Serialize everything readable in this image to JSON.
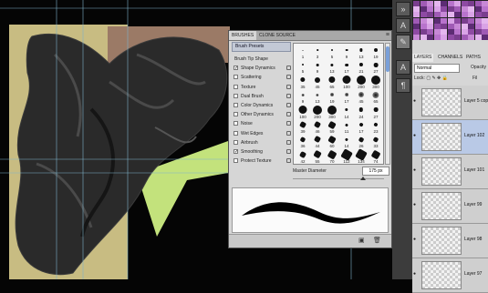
{
  "brushes_panel": {
    "tabs": [
      "BRUSHES",
      "CLONE SOURCE"
    ],
    "presets_button": "Brush Presets",
    "tip_shape_label": "Brush Tip Shape",
    "options": [
      {
        "label": "Shape Dynamics",
        "checked": true
      },
      {
        "label": "Scattering",
        "checked": false
      },
      {
        "label": "Texture",
        "checked": false
      },
      {
        "label": "Dual Brush",
        "checked": false
      },
      {
        "label": "Color Dynamics",
        "checked": false
      },
      {
        "label": "Other Dynamics",
        "checked": false
      },
      {
        "label": "Noise",
        "checked": false
      },
      {
        "label": "Wet Edges",
        "checked": false
      },
      {
        "label": "Airbrush",
        "checked": false
      },
      {
        "label": "Smoothing",
        "checked": true
      },
      {
        "label": "Protect Texture",
        "checked": false
      }
    ],
    "brush_grid": [
      [
        "1",
        "3",
        "5",
        "9",
        "13",
        "19"
      ],
      [
        "5",
        "9",
        "13",
        "17",
        "21",
        "27"
      ],
      [
        "35",
        "45",
        "65",
        "100",
        "200",
        "300"
      ],
      [
        "9",
        "13",
        "19",
        "17",
        "45",
        "65"
      ],
      [
        "100",
        "200",
        "300",
        "14",
        "24",
        "27"
      ],
      [
        "39",
        "46",
        "59",
        "11",
        "17",
        "23"
      ],
      [
        "36",
        "44",
        "60",
        "14",
        "26",
        "33"
      ],
      [
        "42",
        "55",
        "70",
        "112",
        "134",
        "74"
      ]
    ],
    "master_diameter_label": "Master Diameter",
    "master_diameter_value": "175 px"
  },
  "layers_panel": {
    "tabs": [
      "LAYERS",
      "CHANNELS",
      "PATHS"
    ],
    "blend_mode": "Normal",
    "opacity_label": "Opacity",
    "lock_label": "Lock:",
    "fill_label": "Fil",
    "layers": [
      {
        "name": "Layer 5 cop",
        "selected": false
      },
      {
        "name": "Layer 102",
        "selected": true
      },
      {
        "name": "Layer 101",
        "selected": false
      },
      {
        "name": "Layer 99",
        "selected": false
      },
      {
        "name": "Layer 98",
        "selected": false
      },
      {
        "name": "Layer 97",
        "selected": false
      }
    ]
  },
  "colors": {
    "canvas_bg": "#050505",
    "tan_rect": "#c8bc82",
    "brown_rect": "#9b7a66",
    "lime_rect": "#c3e27c",
    "guide_line": "#7fb3c9",
    "swatch_purples": [
      "#7a3e8e",
      "#a05bb5",
      "#c788d6",
      "#e4b6ee",
      "#5d2c74",
      "#b873cc",
      "#d9a3e6",
      "#8e4aa3"
    ]
  },
  "icons": [
    "chevron-icon",
    "panel-menu-icon",
    "lock-icon",
    "eye-icon",
    "brush-tool-icon",
    "type-tool-icon",
    "paragraph-icon",
    "new-preset-icon",
    "trash-icon"
  ]
}
